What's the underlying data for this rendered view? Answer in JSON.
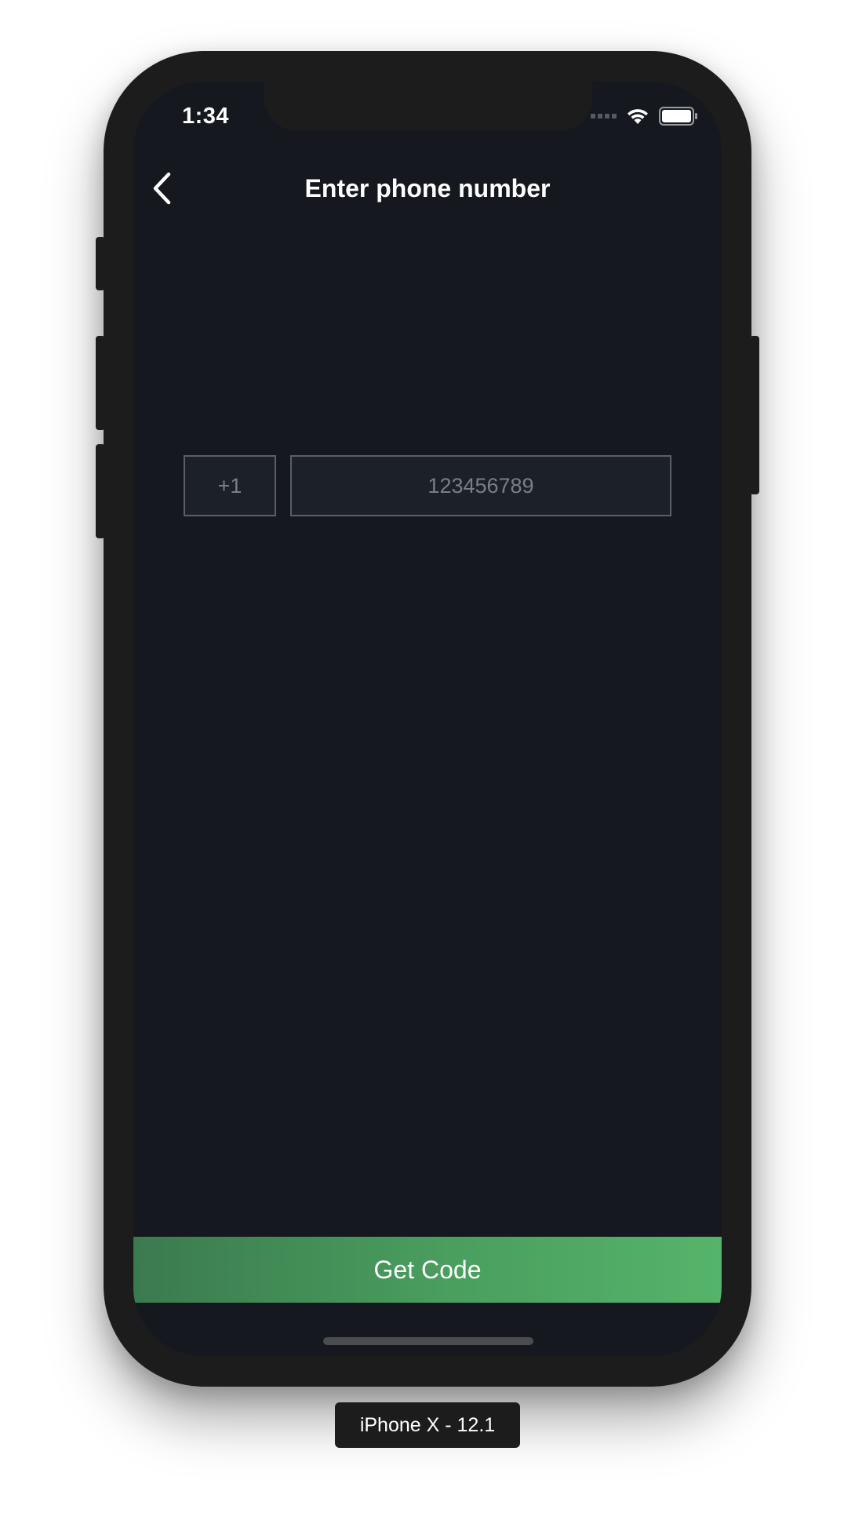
{
  "status_bar": {
    "time": "1:34",
    "icons": [
      "cellular-signal-icon",
      "wifi-icon",
      "battery-icon"
    ]
  },
  "nav": {
    "back_icon": "chevron-left-icon",
    "title": "Enter phone number"
  },
  "phone_form": {
    "country_code": "+1",
    "phone_placeholder": "123456789",
    "phone_value": ""
  },
  "actions": {
    "get_code_label": "Get Code"
  },
  "simulator": {
    "device_label": "iPhone X - 12.1"
  },
  "colors": {
    "background": "#161820",
    "accent_start": "#3b7a4f",
    "accent_end": "#55b46a",
    "input_border": "#5b5f66",
    "placeholder": "#7a7e85"
  }
}
